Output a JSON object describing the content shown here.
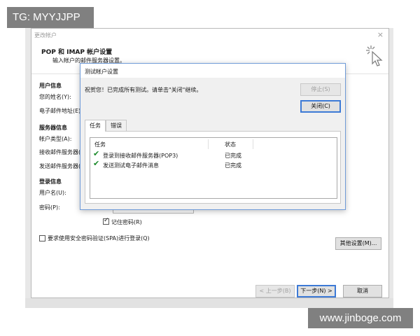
{
  "watermark_top": "TG: MYYJJPP",
  "watermark_bottom": "www.jinboge.com",
  "main_dialog": {
    "title": "更改帐户",
    "close": "×",
    "header_title": "POP 和 IMAP 帐户设置",
    "header_subtitle": "输入帐户的邮件服务器设置。",
    "user_info": {
      "heading": "用户信息",
      "name_label": "您的姓名(Y):",
      "email_label": "电子邮件地址(E)"
    },
    "server_info": {
      "heading": "服务器信息",
      "account_type_label": "帐户类型(A):",
      "incoming_label": "接收邮件服务器(I",
      "outgoing_label": "发送邮件服务器(O"
    },
    "login_info": {
      "heading": "登录信息",
      "username_label": "用户名(U):",
      "password_label": "密码(P):"
    },
    "remember_password": "记住密码(R)",
    "spa_label": "要求使用安全密码验证(SPA)进行登录(Q)",
    "more_settings": "其他设置(M)...",
    "back_button": "< 上一步(B)",
    "next_button": "下一步(N) >",
    "cancel_button": "取消"
  },
  "test_dialog": {
    "title": "测试帐户设置",
    "message": "祝贺您！已完成所有测试。请单击\"关闭\"继续。",
    "stop_button": "停止(S)",
    "close_button": "关闭(C)",
    "tabs": [
      "任务",
      "错误"
    ],
    "columns": [
      "任务",
      "状态"
    ],
    "rows": [
      {
        "task": "登录到接收邮件服务器(POP3)",
        "status": "已完成"
      },
      {
        "task": "发送测试电子邮件消息",
        "status": "已完成"
      }
    ]
  }
}
